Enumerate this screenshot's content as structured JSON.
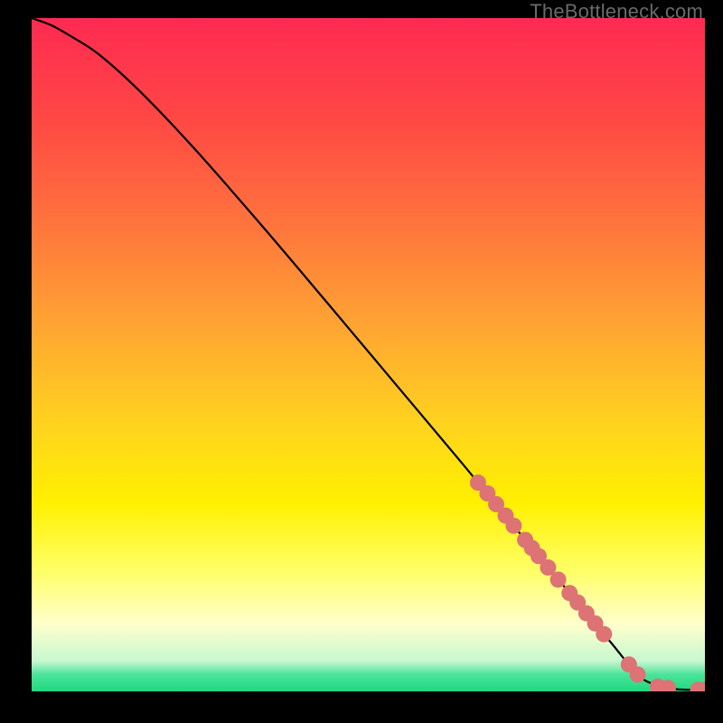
{
  "watermark": "TheBottleneck.com",
  "chart_data": {
    "type": "line",
    "title": "",
    "xlabel": "",
    "ylabel": "",
    "xlim": [
      0,
      100
    ],
    "ylim": [
      0,
      100
    ],
    "grid": false,
    "legend": false,
    "background_gradient": {
      "stops": [
        {
          "pos": 0.0,
          "color": "#ff2a52"
        },
        {
          "pos": 0.14,
          "color": "#ff4545"
        },
        {
          "pos": 0.3,
          "color": "#ff723d"
        },
        {
          "pos": 0.45,
          "color": "#ffa233"
        },
        {
          "pos": 0.6,
          "color": "#ffd21f"
        },
        {
          "pos": 0.72,
          "color": "#fff000"
        },
        {
          "pos": 0.82,
          "color": "#ffff66"
        },
        {
          "pos": 0.9,
          "color": "#ffffcc"
        },
        {
          "pos": 0.955,
          "color": "#c7f8d0"
        },
        {
          "pos": 0.975,
          "color": "#4be49a"
        },
        {
          "pos": 1.0,
          "color": "#1fd87f"
        }
      ]
    },
    "series": [
      {
        "name": "curve",
        "type": "line",
        "color": "#000000",
        "x": [
          0,
          3,
          6,
          10,
          16,
          24,
          34,
          44,
          54,
          64,
          72,
          80,
          86,
          90,
          92.5,
          95,
          97,
          99,
          100
        ],
        "y": [
          100,
          98.9,
          97.2,
          94.6,
          89.2,
          80.8,
          69.4,
          57.6,
          45.7,
          33.8,
          24.1,
          14.5,
          7.3,
          2.5,
          1.0,
          0.4,
          0.25,
          0.22,
          0.22
        ]
      },
      {
        "name": "highlighted-points",
        "type": "scatter",
        "color": "#dd7374",
        "radius_px": 9,
        "x": [
          66.3,
          67.7,
          69.0,
          70.4,
          71.6,
          73.3,
          74.3,
          75.3,
          76.7,
          78.2,
          79.9,
          81.1,
          82.4,
          83.7,
          85.0,
          88.7,
          90.0,
          93.0,
          94.5,
          99.0,
          100.0
        ],
        "y": [
          31.0,
          29.4,
          27.8,
          26.1,
          24.6,
          22.5,
          21.3,
          20.1,
          18.4,
          16.6,
          14.6,
          13.2,
          11.6,
          10.1,
          8.5,
          4.0,
          2.5,
          0.7,
          0.5,
          0.22,
          0.22
        ]
      }
    ]
  }
}
